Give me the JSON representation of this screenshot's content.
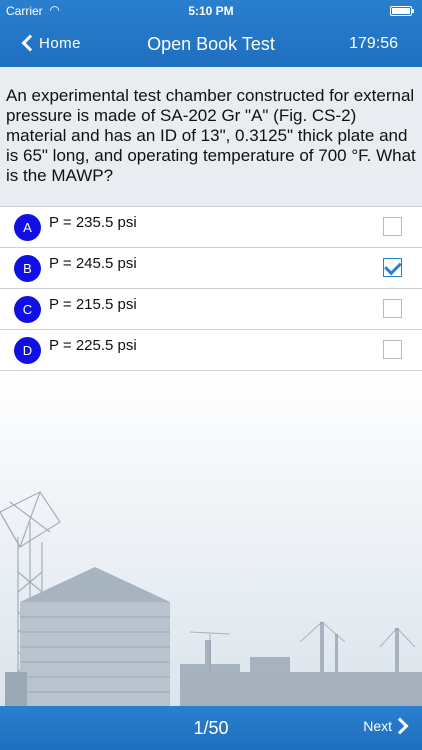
{
  "status_bar": {
    "carrier": "Carrier",
    "time": "5:10 PM"
  },
  "nav": {
    "back_label": "Home",
    "title": "Open Book Test",
    "timer": "179:56"
  },
  "question": {
    "text": "An experimental test chamber constructed for external pressure is made of SA-202 Gr \"A\" (Fig. CS-2) material and has an ID of 13\", 0.3125\" thick plate and is 65\" long, and operating temperature of 700 °F. What is the MAWP?"
  },
  "answers": [
    {
      "letter": "A",
      "text": "P = 235.5 psi",
      "checked": false
    },
    {
      "letter": "B",
      "text": "P = 245.5 psi",
      "checked": true
    },
    {
      "letter": "C",
      "text": "P = 215.5 psi",
      "checked": false
    },
    {
      "letter": "D",
      "text": "P = 225.5 psi",
      "checked": false
    }
  ],
  "footer": {
    "pager": "1/50",
    "next_label": "Next"
  },
  "colors": {
    "bar_blue": "#1f6fbf",
    "badge_blue": "#1010e6",
    "question_bg": "#e9ecf0"
  },
  "icons": {
    "back": "chevron-left-icon",
    "next": "chevron-right-icon",
    "wifi": "wifi-icon",
    "battery": "battery-icon"
  }
}
